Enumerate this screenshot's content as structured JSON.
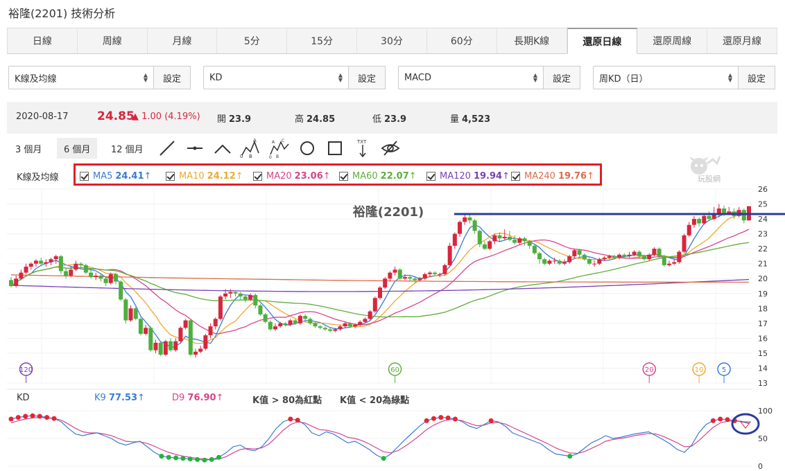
{
  "page": {
    "title": "裕隆(2201) 技術分析"
  },
  "tabs": [
    "日線",
    "周線",
    "月線",
    "5分",
    "15分",
    "30分",
    "60分",
    "長期K線",
    "還原日線",
    "還原周線",
    "還原月線"
  ],
  "active_tab": 8,
  "selectors": [
    {
      "value": "K線及均線",
      "button": "設定"
    },
    {
      "value": "KD",
      "button": "設定"
    },
    {
      "value": "MACD",
      "button": "設定"
    },
    {
      "value": "周KD（日）",
      "button": "設定"
    }
  ],
  "quote": {
    "date": "2020-08-17",
    "price": "24.85",
    "change": "▲ 1.00 (4.19%)",
    "open_label": "開",
    "open": "23.9",
    "high_label": "高",
    "high": "24.85",
    "low_label": "低",
    "low": "23.9",
    "vol_label": "量",
    "vol": "4,523"
  },
  "ranges": [
    "3 個月",
    "6 個月",
    "12 個月"
  ],
  "active_range": 1,
  "tools": [
    "line-tool-icon",
    "horizontal-line-icon",
    "angle-icon",
    "abc-pattern-icon",
    "wave-pattern-icon",
    "circle-icon",
    "rectangle-icon",
    "text-icon",
    "hide-eye-icon"
  ],
  "ma_panel": {
    "label": "K線及均線",
    "items": [
      {
        "name": "MA5",
        "value": "24.41",
        "arrow": "↑",
        "color": "#3a7bd5"
      },
      {
        "name": "MA10",
        "value": "24.12",
        "arrow": "↑",
        "color": "#f0a830"
      },
      {
        "name": "MA20",
        "value": "23.06",
        "arrow": "↑",
        "color": "#d6448c"
      },
      {
        "name": "MA60",
        "value": "22.07",
        "arrow": "↑",
        "color": "#5fae3c"
      },
      {
        "name": "MA120",
        "value": "19.94",
        "arrow": "↑",
        "color": "#7a3fb8"
      },
      {
        "name": "MA240",
        "value": "19.76",
        "arrow": "↑",
        "color": "#e06a4a"
      }
    ]
  },
  "logo_text": "玩股網",
  "chart_data": [
    {
      "type": "candlestick",
      "title": "裕隆(2201)",
      "ylim": [
        13,
        26
      ],
      "y_ticks": [
        "26",
        "25",
        "24",
        "23",
        "22",
        "21",
        "20",
        "19",
        "18",
        "17",
        "16",
        "15",
        "14",
        "13"
      ],
      "candles": [
        [
          19.9,
          19.5,
          20.1,
          19.4
        ],
        [
          19.5,
          20.0,
          20.2,
          19.4
        ],
        [
          20.0,
          20.4,
          20.6,
          19.9
        ],
        [
          20.4,
          20.8,
          21.0,
          20.3
        ],
        [
          20.8,
          21.0,
          21.1,
          20.6
        ],
        [
          21.0,
          21.2,
          21.3,
          20.8
        ],
        [
          21.2,
          21.0,
          21.4,
          20.9
        ],
        [
          21.0,
          21.1,
          21.3,
          20.8
        ],
        [
          21.1,
          21.3,
          21.4,
          20.9
        ],
        [
          21.3,
          21.5,
          21.6,
          21.0
        ],
        [
          21.5,
          20.5,
          21.6,
          20.3
        ],
        [
          20.5,
          20.2,
          20.7,
          20.0
        ],
        [
          20.2,
          20.6,
          20.8,
          20.1
        ],
        [
          20.6,
          21.0,
          21.2,
          20.5
        ],
        [
          21.0,
          20.9,
          21.1,
          20.7
        ],
        [
          20.9,
          20.4,
          21.0,
          20.3
        ],
        [
          20.4,
          20.1,
          20.6,
          20.0
        ],
        [
          20.1,
          20.2,
          20.4,
          19.9
        ],
        [
          20.2,
          20.0,
          20.3,
          19.8
        ],
        [
          20.0,
          19.7,
          20.1,
          19.5
        ],
        [
          19.7,
          20.3,
          20.4,
          19.6
        ],
        [
          20.3,
          19.8,
          20.4,
          19.6
        ],
        [
          19.8,
          18.6,
          19.9,
          18.5
        ],
        [
          18.6,
          17.2,
          18.7,
          17.0
        ],
        [
          17.2,
          18.0,
          18.2,
          17.1
        ],
        [
          18.0,
          17.3,
          18.1,
          17.2
        ],
        [
          17.3,
          16.3,
          17.4,
          16.2
        ],
        [
          16.3,
          16.7,
          16.9,
          16.2
        ],
        [
          16.7,
          15.2,
          16.8,
          15.1
        ],
        [
          15.2,
          15.7,
          15.9,
          15.0
        ],
        [
          15.7,
          14.9,
          15.8,
          14.8
        ],
        [
          14.9,
          15.8,
          15.9,
          14.8
        ],
        [
          15.8,
          15.2,
          16.0,
          15.1
        ],
        [
          15.2,
          15.8,
          16.0,
          15.1
        ],
        [
          15.8,
          16.7,
          16.8,
          15.7
        ],
        [
          16.7,
          17.2,
          17.3,
          16.6
        ],
        [
          17.2,
          14.9,
          17.3,
          14.8
        ],
        [
          14.9,
          15.1,
          15.3,
          14.7
        ],
        [
          15.1,
          15.3,
          15.5,
          15.0
        ],
        [
          15.3,
          16.2,
          16.3,
          15.2
        ],
        [
          16.2,
          16.8,
          17.0,
          16.0
        ],
        [
          16.8,
          17.3,
          17.4,
          16.6
        ],
        [
          17.3,
          18.8,
          18.9,
          17.2
        ],
        [
          18.8,
          19.0,
          19.3,
          18.6
        ],
        [
          19.0,
          19.1,
          19.3,
          18.7
        ],
        [
          19.1,
          19.0,
          19.2,
          18.8
        ],
        [
          19.0,
          18.8,
          19.1,
          18.6
        ],
        [
          18.8,
          18.6,
          18.9,
          18.4
        ],
        [
          18.6,
          18.9,
          19.0,
          18.5
        ],
        [
          18.9,
          18.2,
          19.0,
          18.0
        ],
        [
          18.2,
          17.6,
          18.3,
          17.5
        ],
        [
          17.6,
          17.1,
          17.7,
          17.0
        ],
        [
          17.1,
          16.6,
          17.2,
          16.5
        ],
        [
          16.6,
          16.8,
          17.0,
          16.5
        ],
        [
          16.8,
          17.0,
          17.1,
          16.7
        ],
        [
          17.0,
          16.9,
          17.1,
          16.8
        ],
        [
          16.9,
          17.2,
          17.3,
          16.8
        ],
        [
          17.2,
          17.0,
          17.3,
          16.9
        ],
        [
          17.0,
          17.5,
          17.6,
          16.9
        ],
        [
          17.5,
          17.3,
          17.6,
          17.2
        ],
        [
          17.3,
          17.0,
          17.4,
          16.9
        ],
        [
          17.0,
          16.8,
          17.1,
          16.7
        ],
        [
          16.8,
          16.7,
          16.9,
          16.6
        ],
        [
          16.7,
          16.6,
          16.8,
          16.5
        ],
        [
          16.6,
          16.5,
          16.7,
          16.4
        ],
        [
          16.5,
          16.6,
          16.7,
          16.4
        ],
        [
          16.6,
          16.8,
          16.9,
          16.5
        ],
        [
          16.8,
          17.0,
          17.1,
          16.7
        ],
        [
          17.0,
          16.8,
          17.1,
          16.7
        ],
        [
          16.8,
          16.9,
          17.0,
          16.7
        ],
        [
          16.9,
          17.1,
          17.2,
          16.8
        ],
        [
          17.1,
          17.3,
          17.4,
          17.0
        ],
        [
          17.3,
          17.8,
          17.9,
          17.2
        ],
        [
          17.8,
          18.7,
          18.8,
          17.7
        ],
        [
          18.7,
          19.4,
          19.5,
          18.6
        ],
        [
          19.4,
          20.0,
          20.1,
          19.3
        ],
        [
          20.0,
          20.4,
          20.5,
          19.8
        ],
        [
          20.4,
          20.6,
          20.8,
          20.2
        ],
        [
          20.6,
          20.0,
          20.7,
          19.9
        ],
        [
          20.0,
          20.1,
          20.3,
          19.9
        ],
        [
          20.1,
          20.0,
          20.2,
          19.8
        ],
        [
          20.0,
          19.9,
          20.1,
          19.7
        ],
        [
          19.9,
          20.0,
          20.1,
          19.8
        ],
        [
          20.0,
          20.3,
          20.4,
          19.9
        ],
        [
          20.3,
          20.4,
          20.5,
          20.1
        ],
        [
          20.4,
          20.3,
          20.5,
          20.2
        ],
        [
          20.3,
          20.3,
          20.4,
          20.1
        ],
        [
          20.3,
          20.9,
          21.0,
          20.2
        ],
        [
          20.9,
          22.2,
          22.4,
          20.8
        ],
        [
          22.2,
          23.0,
          23.1,
          22.0
        ],
        [
          23.0,
          23.8,
          23.9,
          22.8
        ],
        [
          23.8,
          24.1,
          24.3,
          23.6
        ],
        [
          24.1,
          23.9,
          24.3,
          23.7
        ],
        [
          23.9,
          23.2,
          24.0,
          23.0
        ],
        [
          23.2,
          22.3,
          23.3,
          22.1
        ],
        [
          22.3,
          22.0,
          22.5,
          21.9
        ],
        [
          22.0,
          22.5,
          22.6,
          21.9
        ],
        [
          22.5,
          22.9,
          23.0,
          22.3
        ],
        [
          22.9,
          22.7,
          23.1,
          22.5
        ],
        [
          22.7,
          22.8,
          23.3,
          22.6
        ],
        [
          22.8,
          22.6,
          23.2,
          22.5
        ],
        [
          22.6,
          22.4,
          22.9,
          22.3
        ],
        [
          22.4,
          22.7,
          22.8,
          22.3
        ],
        [
          22.7,
          22.5,
          22.8,
          22.2
        ],
        [
          22.5,
          22.2,
          22.6,
          22.0
        ],
        [
          22.2,
          21.7,
          22.3,
          21.6
        ],
        [
          21.7,
          21.3,
          21.8,
          21.0
        ],
        [
          21.3,
          21.0,
          21.4,
          20.9
        ],
        [
          21.0,
          21.2,
          21.3,
          20.9
        ],
        [
          21.2,
          21.2,
          21.4,
          21.0
        ],
        [
          21.2,
          21.0,
          21.3,
          20.9
        ],
        [
          21.0,
          21.1,
          21.3,
          20.9
        ],
        [
          21.1,
          21.5,
          21.6,
          21.0
        ],
        [
          21.5,
          21.9,
          22.0,
          21.4
        ],
        [
          21.9,
          21.6,
          22.0,
          21.4
        ],
        [
          21.6,
          21.3,
          21.7,
          21.2
        ],
        [
          21.3,
          21.0,
          21.4,
          20.9
        ],
        [
          21.0,
          21.0,
          21.2,
          20.8
        ],
        [
          21.0,
          21.3,
          21.4,
          20.9
        ],
        [
          21.3,
          21.4,
          21.5,
          21.2
        ],
        [
          21.4,
          21.5,
          21.6,
          21.3
        ],
        [
          21.5,
          21.4,
          21.6,
          21.3
        ],
        [
          21.4,
          21.6,
          21.7,
          21.3
        ],
        [
          21.6,
          21.5,
          21.7,
          21.4
        ],
        [
          21.5,
          21.6,
          21.8,
          21.4
        ],
        [
          21.6,
          21.8,
          21.9,
          21.5
        ],
        [
          21.8,
          21.5,
          21.9,
          21.4
        ],
        [
          21.5,
          21.3,
          21.6,
          21.2
        ],
        [
          21.3,
          21.6,
          21.7,
          21.2
        ],
        [
          21.6,
          22.0,
          22.1,
          21.5
        ],
        [
          22.0,
          21.5,
          22.1,
          21.4
        ],
        [
          21.5,
          20.9,
          21.6,
          20.8
        ],
        [
          20.9,
          21.0,
          21.2,
          20.8
        ],
        [
          21.0,
          21.1,
          21.3,
          20.9
        ],
        [
          21.1,
          21.8,
          21.9,
          21.0
        ],
        [
          21.8,
          22.9,
          23.0,
          21.7
        ],
        [
          22.9,
          23.6,
          23.8,
          22.8
        ],
        [
          23.6,
          24.0,
          24.2,
          23.4
        ],
        [
          24.0,
          23.7,
          24.1,
          23.5
        ],
        [
          23.7,
          24.2,
          24.4,
          23.6
        ],
        [
          24.2,
          24.0,
          24.5,
          23.9
        ],
        [
          24.0,
          24.3,
          24.8,
          23.9
        ],
        [
          24.3,
          24.7,
          25.0,
          24.1
        ],
        [
          24.7,
          24.4,
          24.9,
          24.2
        ],
        [
          24.4,
          24.5,
          24.8,
          24.3
        ],
        [
          24.5,
          24.2,
          24.7,
          24.0
        ],
        [
          24.2,
          24.6,
          24.8,
          24.1
        ],
        [
          24.6,
          23.9,
          24.7,
          23.7
        ],
        [
          23.9,
          24.85,
          24.85,
          23.9
        ]
      ],
      "markers": [
        {
          "label": "120",
          "index": 3,
          "color": "#7a3fb8"
        },
        {
          "label": "60",
          "index": 77,
          "color": "#5fae3c"
        },
        {
          "label": "20",
          "index": 128,
          "color": "#d6448c"
        },
        {
          "label": "10",
          "index": 138,
          "color": "#f0a830"
        },
        {
          "label": "5",
          "index": 143,
          "color": "#3a7bd5"
        }
      ]
    },
    {
      "type": "line",
      "title": "KD",
      "ylim": [
        0,
        100
      ],
      "y_ticks": [
        "100",
        "50",
        "0"
      ],
      "series": [
        {
          "name": "K9",
          "value": "77.53",
          "arrow": "↑",
          "color": "#3a7bd5"
        },
        {
          "name": "D9",
          "value": "76.90",
          "arrow": "↑",
          "color": "#d6448c"
        }
      ],
      "note_red": "K值 > 80為紅點",
      "note_green": "K值 < 20為綠點",
      "k": [
        85,
        88,
        90,
        91,
        90,
        88,
        86,
        80,
        68,
        58,
        55,
        58,
        60,
        55,
        50,
        42,
        38,
        42,
        45,
        35,
        25,
        18,
        16,
        15,
        14,
        13,
        12,
        11,
        12,
        16,
        24,
        35,
        38,
        30,
        28,
        35,
        50,
        68,
        80,
        85,
        83,
        75,
        60,
        55,
        62,
        58,
        50,
        42,
        45,
        38,
        30,
        20,
        14,
        22,
        35,
        48,
        60,
        72,
        82,
        86,
        88,
        87,
        85,
        80,
        72,
        68,
        75,
        82,
        80,
        72,
        60,
        55,
        50,
        45,
        40,
        30,
        22,
        20,
        18,
        22,
        32,
        42,
        48,
        55,
        50,
        52,
        55,
        58,
        60,
        62,
        55,
        48,
        40,
        30,
        25,
        38,
        60,
        75,
        82,
        85,
        84,
        82,
        80,
        77.5
      ],
      "d": [
        78,
        82,
        85,
        87,
        88,
        87,
        86,
        83,
        76,
        68,
        62,
        60,
        60,
        58,
        55,
        50,
        45,
        44,
        44,
        41,
        36,
        30,
        25,
        21,
        18,
        16,
        14,
        13,
        12,
        13,
        17,
        24,
        30,
        32,
        31,
        33,
        40,
        52,
        65,
        75,
        80,
        78,
        72,
        66,
        65,
        62,
        58,
        52,
        50,
        46,
        40,
        33,
        26,
        24,
        28,
        36,
        45,
        55,
        66,
        74,
        80,
        84,
        84,
        82,
        77,
        73,
        74,
        78,
        79,
        76,
        70,
        64,
        58,
        52,
        46,
        40,
        33,
        28,
        24,
        23,
        26,
        32,
        38,
        45,
        48,
        50,
        52,
        55,
        57,
        59,
        58,
        54,
        48,
        42,
        35,
        36,
        46,
        58,
        70,
        78,
        81,
        82,
        81,
        76.9
      ]
    }
  ]
}
